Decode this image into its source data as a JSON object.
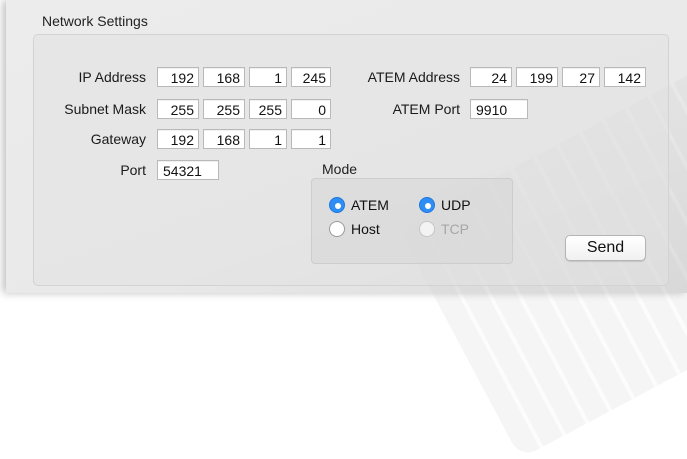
{
  "group": {
    "title": "Network Settings"
  },
  "ip_address": {
    "label": "IP Address",
    "octets": [
      "192",
      "168",
      "1",
      "245"
    ]
  },
  "subnet_mask": {
    "label": "Subnet Mask",
    "octets": [
      "255",
      "255",
      "255",
      "0"
    ]
  },
  "gateway": {
    "label": "Gateway",
    "octets": [
      "192",
      "168",
      "1",
      "1"
    ]
  },
  "port": {
    "label": "Port",
    "value": "54321"
  },
  "atem_address": {
    "label": "ATEM Address",
    "octets": [
      "24",
      "199",
      "27",
      "142"
    ]
  },
  "atem_port": {
    "label": "ATEM Port",
    "value": "9910"
  },
  "mode": {
    "title": "Mode",
    "atem": {
      "label": "ATEM",
      "selected": true
    },
    "host": {
      "label": "Host",
      "selected": false
    },
    "udp": {
      "label": "UDP",
      "selected": true
    },
    "tcp": {
      "label": "TCP",
      "selected": false,
      "enabled": false
    }
  },
  "send_button": {
    "label": "Send"
  },
  "colors": {
    "radio_selected": "#2f8ef5"
  }
}
